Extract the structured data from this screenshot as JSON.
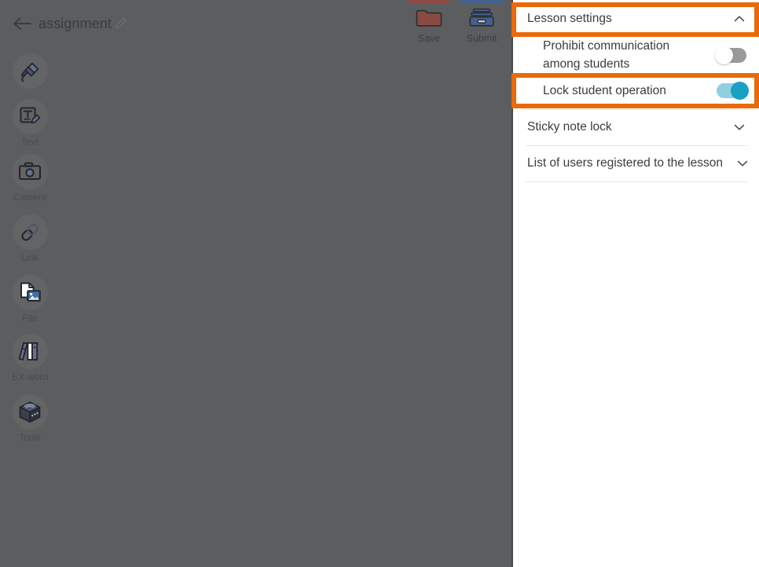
{
  "topbar": {
    "back_icon": "back-arrow-icon",
    "document_title": "assignment",
    "edit_icon": "pencil-edit-icon",
    "buttons": [
      {
        "id": "save",
        "label": "Save",
        "icon": "folder-icon",
        "accent_color": "#8f4a43"
      },
      {
        "id": "submit",
        "label": "Submit",
        "icon": "tray-inbox-icon",
        "accent_color": "#44618e"
      }
    ]
  },
  "toolrail": {
    "items": [
      {
        "id": "highlighter",
        "label": "",
        "icon": "highlighter-pen-icon"
      },
      {
        "id": "text",
        "label": "Text",
        "icon": "text-edit-icon"
      },
      {
        "id": "camera",
        "label": "Camera",
        "icon": "camera-icon"
      },
      {
        "id": "link",
        "label": "Link",
        "icon": "link-chain-icon"
      },
      {
        "id": "file",
        "label": "File",
        "icon": "file-image-icon"
      },
      {
        "id": "exword",
        "label": "EX-word",
        "icon": "books-icon"
      },
      {
        "id": "tools",
        "label": "Tools",
        "icon": "toolbox-cube-icon"
      }
    ]
  },
  "panel": {
    "sections": [
      {
        "id": "lesson-settings",
        "title": "Lesson settings",
        "chevron": "chevron-up-icon",
        "expanded": true
      },
      {
        "id": "sticky-note-lock",
        "title": "Sticky note lock",
        "chevron": "chevron-down-icon",
        "expanded": false
      },
      {
        "id": "registered-users",
        "title": "List of users registered to the lesson",
        "chevron": "chevron-down-icon",
        "expanded": false
      }
    ],
    "settings": [
      {
        "id": "prohibit-communication",
        "label": "Prohibit communication among students",
        "toggle_state": "off"
      },
      {
        "id": "lock-student-operation",
        "label": "Lock student operation",
        "toggle_state": "on"
      }
    ]
  },
  "annotations": {
    "highlight_color": "#ea6a0a",
    "boxes": [
      {
        "id": "highlight-lesson-settings",
        "target": "lesson-settings"
      },
      {
        "id": "highlight-lock-student-operation",
        "target": "lock-student-operation"
      }
    ]
  },
  "colors": {
    "dim_overlay": "#5c5d5f",
    "toggle_on_track": "#8ecfe0",
    "toggle_on_knob": "#19a0c4",
    "toggle_off_track": "#9a9a9a",
    "panel_background": "#ffffff",
    "text_primary": "#3b3c3e"
  }
}
